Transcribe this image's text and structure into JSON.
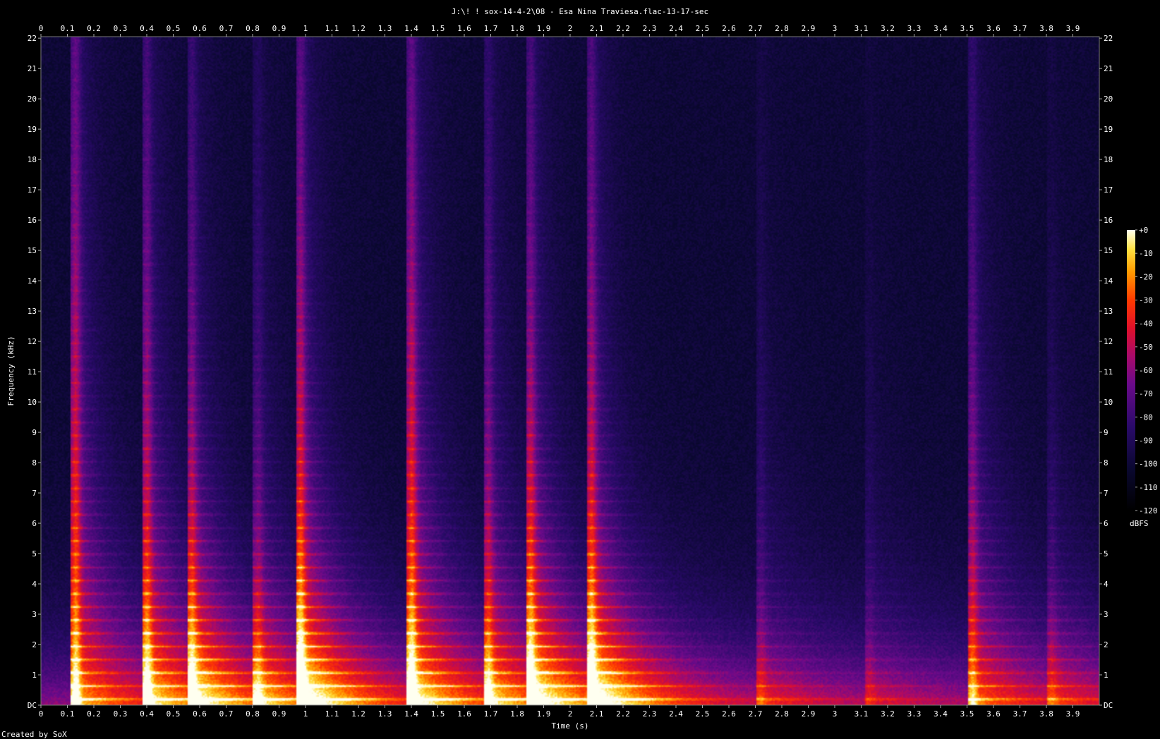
{
  "chart_data": {
    "type": "heatmap",
    "title": "J:\\! ! sox-14-4-2\\08 - Esa Nina Traviesa.flac-13-17-sec",
    "xlabel": "Time (s)",
    "ylabel": "Frequency (kHz)",
    "footer": "Created by SoX",
    "xlim": [
      0,
      4.0
    ],
    "ylim": [
      0,
      22.05
    ],
    "x_ticks": [
      "0",
      "0.1",
      "0.2",
      "0.3",
      "0.4",
      "0.5",
      "0.6",
      "0.7",
      "0.8",
      "0.9",
      "1",
      "1.1",
      "1.2",
      "1.3",
      "1.4",
      "1.5",
      "1.6",
      "1.7",
      "1.8",
      "1.9",
      "2",
      "2.1",
      "2.2",
      "2.3",
      "2.4",
      "2.5",
      "2.6",
      "2.7",
      "2.8",
      "2.9",
      "3",
      "3.1",
      "3.2",
      "3.3",
      "3.4",
      "3.5",
      "3.6",
      "3.7",
      "3.8",
      "3.9"
    ],
    "y_ticks": [
      "DC",
      "1",
      "2",
      "3",
      "4",
      "5",
      "6",
      "7",
      "8",
      "9",
      "10",
      "11",
      "12",
      "13",
      "14",
      "15",
      "16",
      "17",
      "18",
      "19",
      "20",
      "21",
      "22"
    ],
    "colorbar": {
      "label": "dBFS",
      "range": [
        -120,
        0
      ],
      "ticks": [
        "+0",
        "-10",
        "-20",
        "-30",
        "-40",
        "-50",
        "-60",
        "-70",
        "-80",
        "-90",
        "-100",
        "-110",
        "-120"
      ]
    },
    "onsets": [
      {
        "t": 0.13,
        "strength": 1.0
      },
      {
        "t": 0.4,
        "strength": 0.85
      },
      {
        "t": 0.57,
        "strength": 0.75
      },
      {
        "t": 0.82,
        "strength": 0.55
      },
      {
        "t": 0.98,
        "strength": 0.95
      },
      {
        "t": 1.4,
        "strength": 1.0
      },
      {
        "t": 1.69,
        "strength": 0.7
      },
      {
        "t": 1.85,
        "strength": 0.85
      },
      {
        "t": 2.08,
        "strength": 0.9
      },
      {
        "t": 2.72,
        "strength": 0.35
      },
      {
        "t": 3.13,
        "strength": 0.25
      },
      {
        "t": 3.52,
        "strength": 0.7
      },
      {
        "t": 3.82,
        "strength": 0.3
      }
    ],
    "noise_floor_dbfs": -100
  }
}
